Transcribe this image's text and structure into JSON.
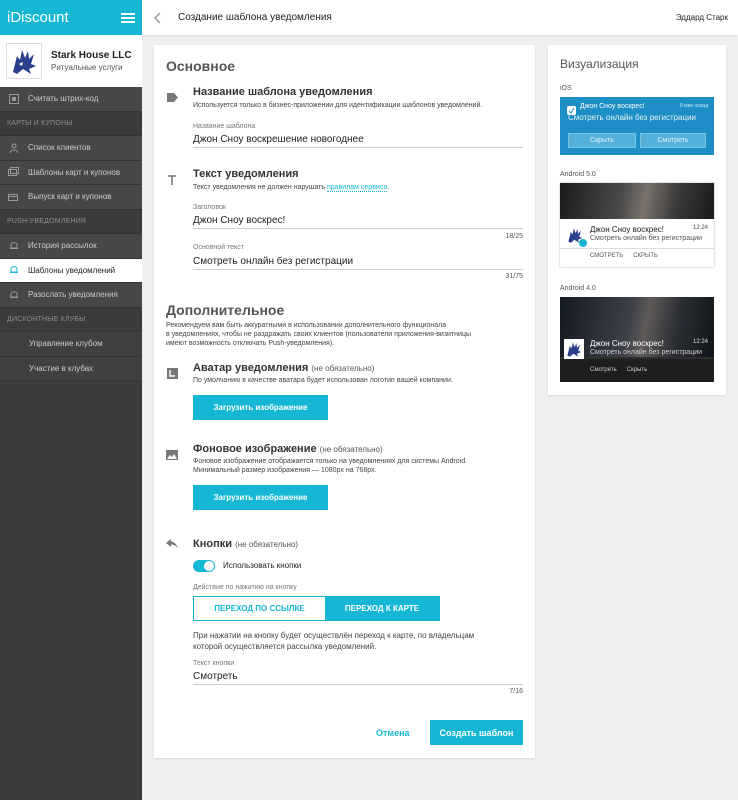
{
  "app": {
    "brand": "iDiscount"
  },
  "company": {
    "name": "Stark House LLC",
    "subtitle": "Ритуальные услуги"
  },
  "sidebar": {
    "scan": "Считать штрих-код",
    "section_cards": "Карты и купоны",
    "clients": "Список клиентов",
    "templates": "Шаблоны карт и купонов",
    "issue": "Выпуск карт и купонов",
    "section_push": "Push-уведомления",
    "history": "История рассылок",
    "notif_templates": "Шаблоны уведомлений",
    "resend": "Разослать уведомления",
    "section_clubs": "Дисконтные клубы",
    "club_manage": "Управление клубом",
    "club_join": "Участие в клубах"
  },
  "topbar": {
    "title": "Создание шаблона уведомления",
    "user": "Эддард Старк"
  },
  "form": {
    "basic_heading": "Основное",
    "name_section": {
      "title": "Название шаблона уведомления",
      "desc": "Используется только в бизнес-приложении для идентификации шаблонов уведомлений.",
      "label": "Название шаблона",
      "value": "Джон Сноу воскрешение новогоднее"
    },
    "text_section": {
      "title": "Текст уведомления",
      "desc": "Текст уведомления не должен нарушать",
      "link": "правилам сервиса",
      "desc_end": ".",
      "header_label": "Заголовок",
      "header_value": "Джон Сноу воскрес!",
      "header_counter": "18/25",
      "body_label": "Основной текст",
      "body_value": "Смотреть онлайн без регистрации",
      "body_counter": "31/75"
    },
    "additional_heading": "Дополнительное",
    "additional_desc_1": "Рекомендуем вам быть аккуратными в использовании дополнительного функционала",
    "additional_desc_2": "в уведомлениях, чтобы не раздражать своих клиентов (пользователи приложения-визитницы",
    "additional_desc_3": "имеют возможность отключать Push-уведомления).",
    "avatar": {
      "title": "Аватар уведомления",
      "optional": "(не обязательно)",
      "desc": "По умолчанию в качестве аватара будет использован логотип вашей компании.",
      "button": "Загрузить изображение"
    },
    "background": {
      "title": "Фоновое изображение",
      "optional": "(не обязательно)",
      "desc_1": "Фоновое изображение отображается только на уведомлениях для системы Android.",
      "desc_2": "Минимальный размер изображения — 1080px на 768px.",
      "button": "Загрузить изображение"
    },
    "buttons": {
      "title": "Кнопки",
      "optional": "(не обязательно)",
      "toggle_label": "Использовать кнопки",
      "action_label": "Действие по нажатию на кнопку",
      "seg_link": "ПЕРЕХОД ПО ССЫЛКЕ",
      "seg_card": "ПЕРЕХОД К КАРТЕ",
      "note_1": "При нажатии на кнопку будет осуществлён переход к карте, по владельцам",
      "note_2": "которой осуществляется рассылка уведомлений.",
      "text_label": "Текст кнопки",
      "text_value": "Смотреть",
      "text_counter": "7/16"
    },
    "cancel": "Отмена",
    "create": "Создать шаблон"
  },
  "viz": {
    "title": "Визуализация",
    "ios_label": "iOS",
    "ios_title": "Джон Сноу воскрес!",
    "ios_ago": "8 мин назад",
    "ios_text": "Смотреть онлайн без регистрации",
    "ios_hide": "Скрыть",
    "ios_watch": "Смотреть",
    "a5_label": "Android 5.0",
    "a5_title": "Джон Сноу воскрес!",
    "a5_time": "12:24",
    "a5_text": "Смотреть онлайн без регистрации",
    "a5_watch": "СМОТРЕТЬ",
    "a5_hide": "СКРЫТЬ",
    "a4_label": "Android 4.0",
    "a4_title": "Джон Сноу воскрес!",
    "a4_time": "12:24",
    "a4_text": "Смотреть онлайн без регистрации",
    "a4_watch": "Смотреть",
    "a4_hide": "Скрыть"
  },
  "colors": {
    "accent": "#16b7d4",
    "sidebar": "#3b3b3b"
  }
}
